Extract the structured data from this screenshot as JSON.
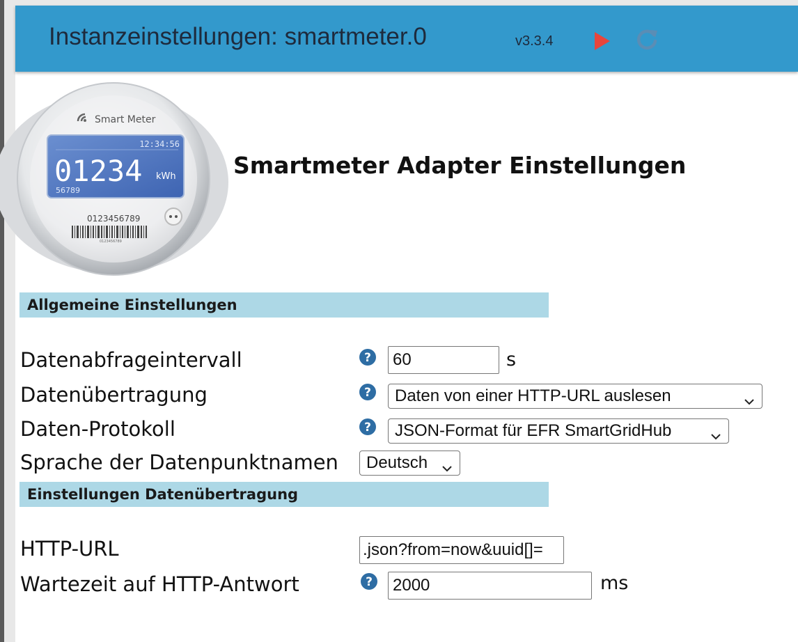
{
  "header": {
    "title": "Instanzeinstellungen: smartmeter.0",
    "version": "v3.3.4",
    "play_icon": "play-icon",
    "reload_icon": "reload-icon",
    "color": "#3399cc"
  },
  "logo": {
    "brand": "Smart Meter",
    "time": "12:34:56",
    "reading": "01234",
    "unit": "kWh",
    "sub": "56789",
    "serial": "0123456789",
    "barcode_text": "0123456789"
  },
  "page_title": "Smartmeter Adapter Einstellungen",
  "sections": {
    "general": {
      "title": "Allgemeine Einstellungen",
      "rows": {
        "interval": {
          "label": "Datenabfrageintervall",
          "value": "60",
          "unit": "s"
        },
        "transfer": {
          "label": "Datenübertragung",
          "selected": "Daten von einer HTTP-URL auslesen"
        },
        "protocol": {
          "label": "Daten-Protokoll",
          "selected": "JSON-Format für EFR SmartGridHub"
        },
        "language": {
          "label": "Sprache der Datenpunktnamen",
          "selected": "Deutsch"
        }
      }
    },
    "transfer": {
      "title": "Einstellungen Datenübertragung",
      "rows": {
        "url": {
          "label": "HTTP-URL",
          "value": ".json?from=now&uuid[]="
        },
        "timeout": {
          "label": "Wartezeit auf HTTP-Antwort",
          "value": "2000",
          "unit": "ms"
        }
      }
    }
  },
  "colors": {
    "section_bg": "#add8e6",
    "help_icon": "#2e6da4",
    "play": "#e8453c"
  }
}
